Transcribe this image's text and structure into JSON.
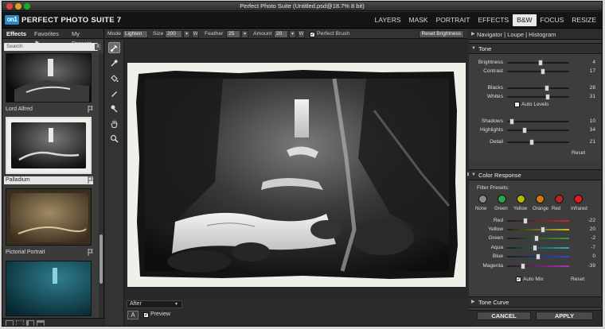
{
  "window": {
    "title": "Perfect Photo Suite (Untitled.psd@18.7% 8 bit)"
  },
  "brand": {
    "logo_text": "on1",
    "name": "PERFECT PHOTO SUITE 7"
  },
  "modules": [
    {
      "label": "LAYERS"
    },
    {
      "label": "MASK"
    },
    {
      "label": "PORTRAIT"
    },
    {
      "label": "EFFECTS"
    },
    {
      "label": "B&W",
      "active": true
    },
    {
      "label": "FOCUS"
    },
    {
      "label": "RESIZE"
    }
  ],
  "left_panel": {
    "tabs": [
      {
        "label": "Effects"
      },
      {
        "label": "Favorites ⚑"
      },
      {
        "label": "My Presets"
      }
    ],
    "search_placeholder": "Search",
    "search_clear": "X",
    "presets": [
      {
        "label": "Lord Alfred"
      },
      {
        "label": "Palladium",
        "selected": true
      },
      {
        "label": "Pictorial Portrait"
      }
    ]
  },
  "toolbar": {
    "mode_label": "Mode",
    "mode_value": "Lighten",
    "size_label": "Size",
    "size_value": "200",
    "size_btn": "W",
    "feather_label": "Feather",
    "feather_value": "25",
    "amount_label": "Amount",
    "amount_value": "20",
    "amount_btn": "W",
    "perfect_brush_label": "Perfect Brush",
    "perfect_brush_checked": true,
    "reset_brightness_label": "Reset Brightness"
  },
  "tools": [
    "brush-tool",
    "eyedropper-tool",
    "paint-bucket-tool",
    "pen-tool",
    "color-picker-tool",
    "hand-tool",
    "zoom-tool"
  ],
  "bottom_bar": {
    "view_select": "After",
    "compare_btn": "A",
    "preview_label": "Preview",
    "preview_checked": true
  },
  "right_panel": {
    "nav_tabs": "Navigator | Loupe | Histogram",
    "tone": {
      "header": "Tone",
      "sliders": [
        {
          "label": "Brightness",
          "value": 4,
          "pos": 0.54
        },
        {
          "label": "Contrast",
          "value": 17,
          "pos": 0.58
        },
        {
          "label": "Blacks",
          "value": 28,
          "pos": 0.64
        },
        {
          "label": "Whites",
          "value": 31,
          "pos": 0.66
        },
        {
          "label": "Shadows",
          "value": 10,
          "pos": 0.08
        },
        {
          "label": "Highlights",
          "value": 34,
          "pos": 0.28
        },
        {
          "label": "Detail",
          "value": 21,
          "pos": 0.4
        }
      ],
      "auto_levels_label": "Auto Levels",
      "auto_levels_checked": false,
      "reset_label": "Reset"
    },
    "color_response": {
      "header": "Color Response",
      "filter_presets_label": "Filter Presets:",
      "presets": [
        {
          "label": "None",
          "color": "#8a8a8a"
        },
        {
          "label": "Green",
          "color": "#2fa34a"
        },
        {
          "label": "Yellow",
          "color": "#b8b800"
        },
        {
          "label": "Orange",
          "color": "#d17a12"
        },
        {
          "label": "Red",
          "color": "#b3252a"
        },
        {
          "label": "Infrared",
          "color": "#e31c1c"
        }
      ],
      "sliders": [
        {
          "label": "Red",
          "value": -22,
          "pos": 0.3,
          "color": "#c82828"
        },
        {
          "label": "Yellow",
          "value": 20,
          "pos": 0.58,
          "color": "#c8c020"
        },
        {
          "label": "Green",
          "value": -2,
          "pos": 0.48,
          "color": "#30a040"
        },
        {
          "label": "Aqua",
          "value": -7,
          "pos": 0.45,
          "color": "#20b0b0"
        },
        {
          "label": "Blue",
          "value": 0,
          "pos": 0.5,
          "color": "#2a4ad0"
        },
        {
          "label": "Magenta",
          "value": -39,
          "pos": 0.25,
          "color": "#b030b0"
        }
      ],
      "auto_mix_label": "Auto Mix",
      "auto_mix_checked": true,
      "reset_label": "Reset"
    },
    "tone_curve_header": "Tone Curve",
    "cancel_label": "CANCEL",
    "apply_label": "APPLY"
  }
}
